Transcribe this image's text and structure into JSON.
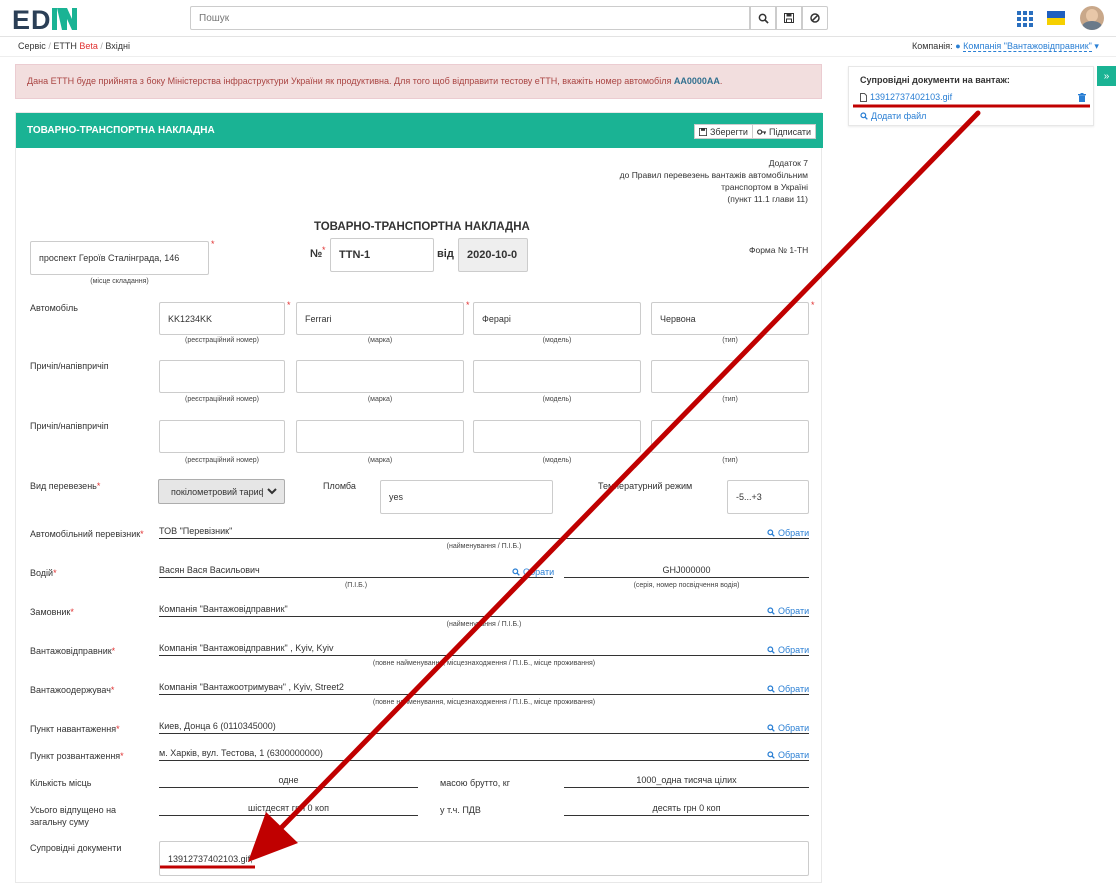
{
  "header": {
    "logo_text": "EDIN",
    "search_placeholder": "Пошук"
  },
  "breadcrumb": {
    "items": [
      "Сервіс",
      "ЕТТН",
      "Beta",
      "Вхідні"
    ],
    "company_label": "Компанія:",
    "company_value": "Компанія \"Вантажовідправник\""
  },
  "alert": {
    "text": "Дана ЕТТН буде прийнята з боку Міністерства інфраструктури України як продуктивна. Для того щоб відправити тестову еТТН, вкажіть номер автомобіля ",
    "plate": "AA0000AA",
    "end": "."
  },
  "panel": {
    "title": "ТОВАРНО-ТРАНСПОРТНА НАКЛАДНА",
    "save_label": "Зберегти",
    "sign_label": "Підписати"
  },
  "doc": {
    "annex": [
      "Додаток 7",
      "до Правил перевезень вантажів автомобільним",
      "транспортом в Україні",
      "(пункт 11.1 глави 11)"
    ],
    "title": "ТОВАРНО-ТРАНСПОРТНА НАКЛАДНА",
    "place_value": "проспект Героїв Сталінграда, 146",
    "place_caption": "(місце складання)",
    "num_label": "№",
    "num_value": "TTN-1",
    "date_label": "від",
    "date_value": "2020-10-0",
    "form_label": "Форма № 1-ТН",
    "vehicle_label": "Автомобіль",
    "trailer1_label": "Причіп/напівпричіп",
    "trailer2_label": "Причіп/напівпричіп",
    "vehicle": {
      "reg": "KK1234KK",
      "brand": "Ferrari",
      "model": "Ферарі",
      "type": "Червона"
    },
    "caps": {
      "reg": "(реєстраційний номер)",
      "brand": "(марка)",
      "model": "(модель)",
      "type": "(тип)"
    },
    "transport_label": "Вид перевезень",
    "transport_value": "покілометровий тариф",
    "seal_label": "Пломба",
    "seal_value": "yes",
    "temp_label": "Температурний режим",
    "temp_value": "-5...+3",
    "carrier_label": "Автомобільний перевізник",
    "carrier_value": "ТОВ \"Перевізник\"",
    "carrier_caption": "(найменування / П.І.Б.)",
    "driver_label": "Водій",
    "driver_value": "Васян Вася Васильович",
    "driver_caption": "(П.І.Б.)",
    "license_value": "GHJ000000",
    "license_caption": "(серія, номер посвідчення водія)",
    "customer_label": "Замовник",
    "customer_value": "Компанія \"Вантажовідправник\"",
    "customer_caption": "(найменування / П.І.Б.)",
    "shipper_label": "Вантажовідправник",
    "shipper_value": "Компанія \"Вантажовідправник\" , Kyiv, Kyiv",
    "shipper_caption": "(повне найменування, місцезнаходження / П.І.Б., місце проживання)",
    "consignee_label": "Вантажоодержувач",
    "consignee_value": "Компанія \"Вантажоотримувач\" , Kyiv, Street2",
    "consignee_caption": "(повне найменування, місцезнаходження / П.І.Б., місце проживання)",
    "load_label": "Пункт навантаження",
    "load_value": "Киев, Донца 6 (0110345000)",
    "unload_label": "Пункт розвантаження",
    "unload_value": "м. Харків, вул. Тестова, 1 (6300000000)",
    "qty_label": "Кількість місць",
    "qty_value": "одне",
    "gross_label": "масою брутто, кг",
    "gross_value": "1000_одна тисяча цілих",
    "total_label": "Усього відпущено на загальну суму",
    "total_value": "шістдесят грн 0 коп",
    "vat_label": "у т.ч. ПДВ",
    "vat_value": "десять грн 0 коп",
    "docs_label": "Супровідні документи",
    "docs_value": "13912737402103.gif;",
    "pick_label": "Обрати"
  },
  "side": {
    "title": "Супровідні документи на вантаж:",
    "file": "13912737402103.gif",
    "add_label": "Додати файл",
    "toggle": "»"
  },
  "colors": {
    "accent": "#1ab394",
    "link": "#2a7fd4",
    "required": "#e03131",
    "annotation": "#c00000"
  }
}
